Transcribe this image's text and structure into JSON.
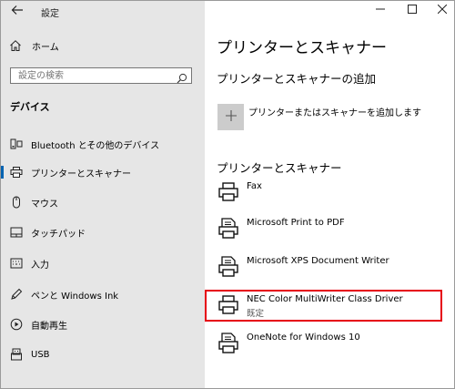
{
  "titlebar": {
    "title": "設定"
  },
  "sidebar": {
    "home_label": "ホーム",
    "search_placeholder": "設定の検索",
    "section_title": "デバイス",
    "items": [
      {
        "label": "Bluetooth とその他のデバイス",
        "icon": "bluetooth-devices-icon",
        "selected": false
      },
      {
        "label": "プリンターとスキャナー",
        "icon": "printer-icon",
        "selected": true
      },
      {
        "label": "マウス",
        "icon": "mouse-icon",
        "selected": false
      },
      {
        "label": "タッチパッド",
        "icon": "touchpad-icon",
        "selected": false
      },
      {
        "label": "入力",
        "icon": "keyboard-icon",
        "selected": false
      },
      {
        "label": "ペンと Windows Ink",
        "icon": "pen-icon",
        "selected": false
      },
      {
        "label": "自動再生",
        "icon": "autoplay-icon",
        "selected": false
      },
      {
        "label": "USB",
        "icon": "usb-icon",
        "selected": false
      }
    ]
  },
  "main": {
    "title": "プリンターとスキャナー",
    "add_heading": "プリンターとスキャナーの追加",
    "add_button_label": "プリンターまたはスキャナーを追加します",
    "list_heading": "プリンターとスキャナー",
    "printers": [
      {
        "name": "Fax",
        "status": ""
      },
      {
        "name": "Microsoft Print to PDF",
        "status": ""
      },
      {
        "name": "Microsoft XPS Document Writer",
        "status": ""
      },
      {
        "name": "NEC Color MultiWriter Class Driver",
        "status": "既定",
        "highlighted": true
      },
      {
        "name": "OneNote for Windows 10",
        "status": ""
      }
    ]
  },
  "colors": {
    "sidebar_bg": "#e6e6e6",
    "accent": "#0063b1",
    "highlight_border": "#e60012",
    "add_button_bg": "#cccccc"
  }
}
